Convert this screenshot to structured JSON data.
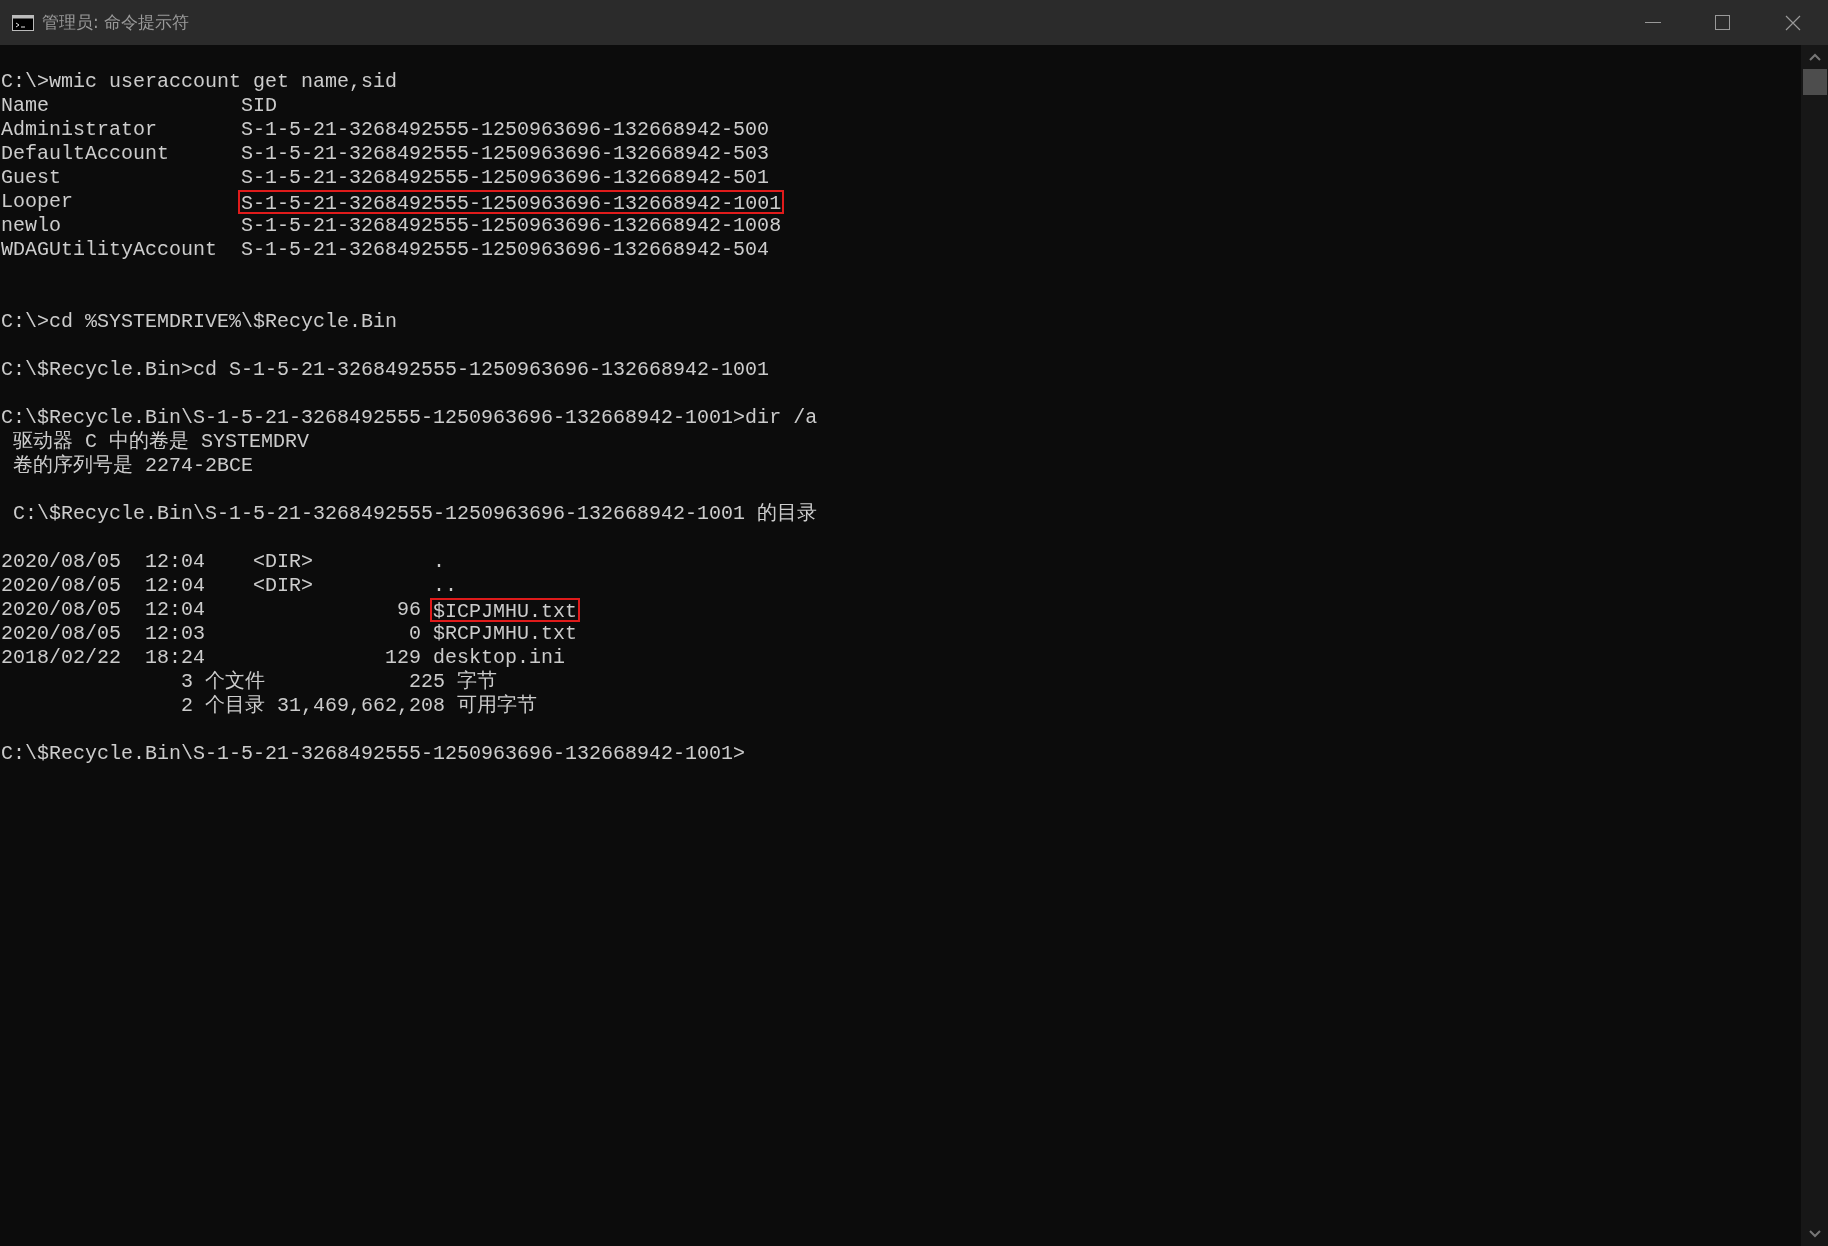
{
  "window": {
    "title": "管理员: 命令提示符"
  },
  "console": {
    "blocks": [
      {
        "lines": [
          {
            "text": "C:\\>wmic useraccount get name,sid"
          },
          {
            "text": "Name                SID"
          },
          {
            "text": "Administrator       S-1-5-21-3268492555-1250963696-132668942-500"
          },
          {
            "text": "DefaultAccount      S-1-5-21-3268492555-1250963696-132668942-503"
          },
          {
            "text": "Guest               S-1-5-21-3268492555-1250963696-132668942-501"
          },
          {
            "text": "Looper              ",
            "boxed": "S-1-5-21-3268492555-1250963696-132668942-1001"
          },
          {
            "text": "newlo               S-1-5-21-3268492555-1250963696-132668942-1008"
          },
          {
            "text": "WDAGUtilityAccount  S-1-5-21-3268492555-1250963696-132668942-504"
          }
        ]
      },
      {
        "lines": [
          {
            "text": "C:\\>cd %SYSTEMDRIVE%\\$Recycle.Bin"
          }
        ]
      },
      {
        "lines": [
          {
            "text": "C:\\$Recycle.Bin>cd S-1-5-21-3268492555-1250963696-132668942-1001"
          }
        ]
      },
      {
        "lines": [
          {
            "text": "C:\\$Recycle.Bin\\S-1-5-21-3268492555-1250963696-132668942-1001>dir /a"
          },
          {
            "text": " 驱动器 C 中的卷是 SYSTEMDRV"
          },
          {
            "text": " 卷的序列号是 2274-2BCE"
          }
        ]
      },
      {
        "lines": [
          {
            "text": " C:\\$Recycle.Bin\\S-1-5-21-3268492555-1250963696-132668942-1001 的目录"
          }
        ]
      },
      {
        "lines": [
          {
            "text": "2020/08/05  12:04    <DIR>          ."
          },
          {
            "text": "2020/08/05  12:04    <DIR>          .."
          },
          {
            "text": "2020/08/05  12:04                96 ",
            "boxed": "$ICPJMHU.txt"
          },
          {
            "text": "2020/08/05  12:03                 0 $RCPJMHU.txt"
          },
          {
            "text": "2018/02/22  18:24               129 desktop.ini"
          },
          {
            "text": "               3 个文件            225 字节"
          },
          {
            "text": "               2 个目录 31,469,662,208 可用字节"
          }
        ]
      },
      {
        "lines": [
          {
            "text": "C:\\$Recycle.Bin\\S-1-5-21-3268492555-1250963696-132668942-1001>"
          }
        ]
      }
    ]
  }
}
